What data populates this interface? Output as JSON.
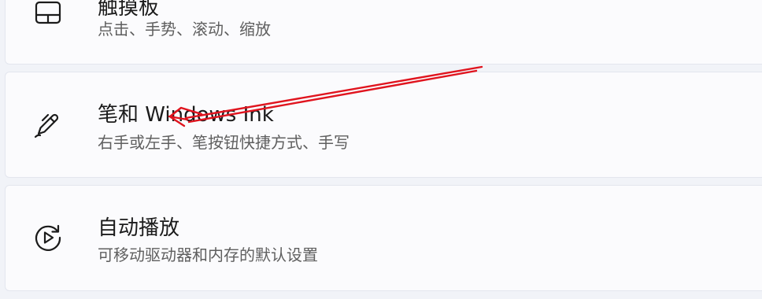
{
  "settings_items": [
    {
      "title": "触摸板",
      "subtitle": "点击、手势、滚动、缩放",
      "icon": "touchpad-icon"
    },
    {
      "title": "笔和 Windows Ink",
      "subtitle": "右手或左手、笔按钮快捷方式、手写",
      "icon": "pen-icon"
    },
    {
      "title": "自动播放",
      "subtitle": "可移动驱动器和内存的默认设置",
      "icon": "autoplay-icon"
    }
  ],
  "colors": {
    "background": "#f1f3f8",
    "card": "#fbfbfd",
    "title_text": "#1b1b1b",
    "subtitle_text": "#5f5f5f",
    "annotation_arrow": "#e0141e"
  }
}
